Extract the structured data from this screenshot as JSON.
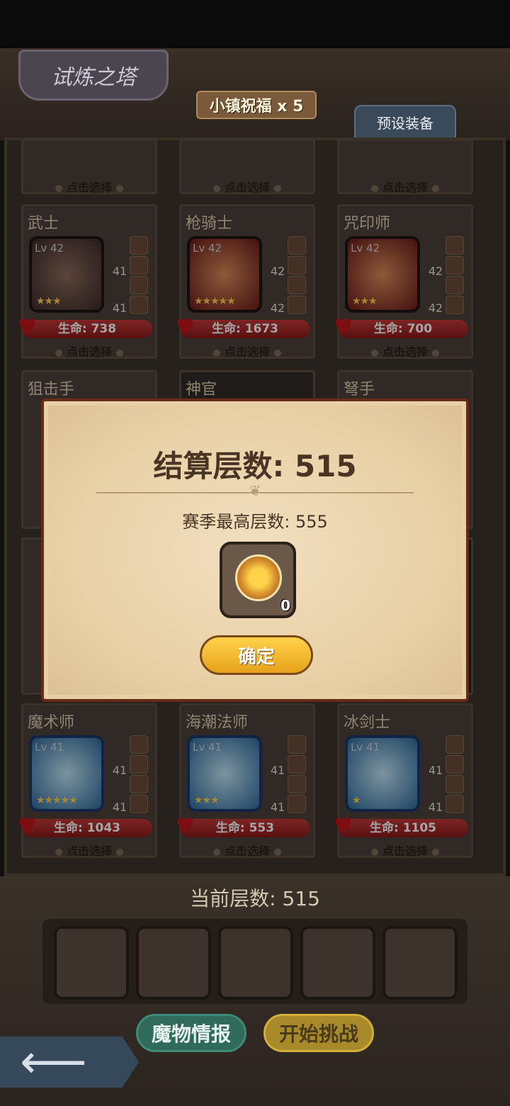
{
  "header": {
    "title": "试炼之塔",
    "blessing": "小镇祝福 x 5",
    "preset_tab": "预设装备"
  },
  "roster": {
    "top_row_pick": [
      "点击选择",
      "点击选择",
      "点击选择"
    ],
    "cards": [
      {
        "name": "武士",
        "lv": "Lv 42",
        "stat1": "41",
        "stat2": "41",
        "hp": "生命: 738",
        "pick": "点击选择",
        "stars": "★★★"
      },
      {
        "name": "枪骑士",
        "lv": "Lv 42",
        "stat1": "42",
        "stat2": "42",
        "hp": "生命: 1673",
        "pick": "点击选择",
        "stars": "★★★★★"
      },
      {
        "name": "咒印师",
        "lv": "Lv 42",
        "stat1": "42",
        "stat2": "42",
        "hp": "生命: 700",
        "pick": "点击选择",
        "stars": "★★★"
      },
      {
        "name": "狙击手"
      },
      {
        "name": "神官"
      },
      {
        "name": "弩手"
      },
      {
        "name": "魔术师",
        "lv": "Lv 41",
        "stat1": "41",
        "stat2": "41",
        "hp": "生命: 1043",
        "pick": "点击选择",
        "stars": "★★★★★"
      },
      {
        "name": "海潮法师",
        "lv": "Lv 41",
        "stat1": "41",
        "stat2": "41",
        "hp": "生命: 553",
        "pick": "点击选择",
        "stars": "★★★"
      },
      {
        "name": "冰剑士",
        "lv": "Lv 41",
        "stat1": "41",
        "stat2": "41",
        "hp": "生命: 1105",
        "pick": "点击选择",
        "stars": "★"
      }
    ]
  },
  "bottom": {
    "current_floor": "当前层数: 515",
    "monster_info": "魔物情报",
    "start": "开始挑战"
  },
  "modal": {
    "title": "结算层数: 515",
    "season_best": "赛季最高层数: 555",
    "reward_count": "0",
    "confirm": "确定"
  },
  "icons": [
    "back-arrow-icon",
    "heart-icon",
    "medal-icon",
    "star-icon",
    "sword-icon",
    "helmet-icon",
    "lock-icon"
  ]
}
